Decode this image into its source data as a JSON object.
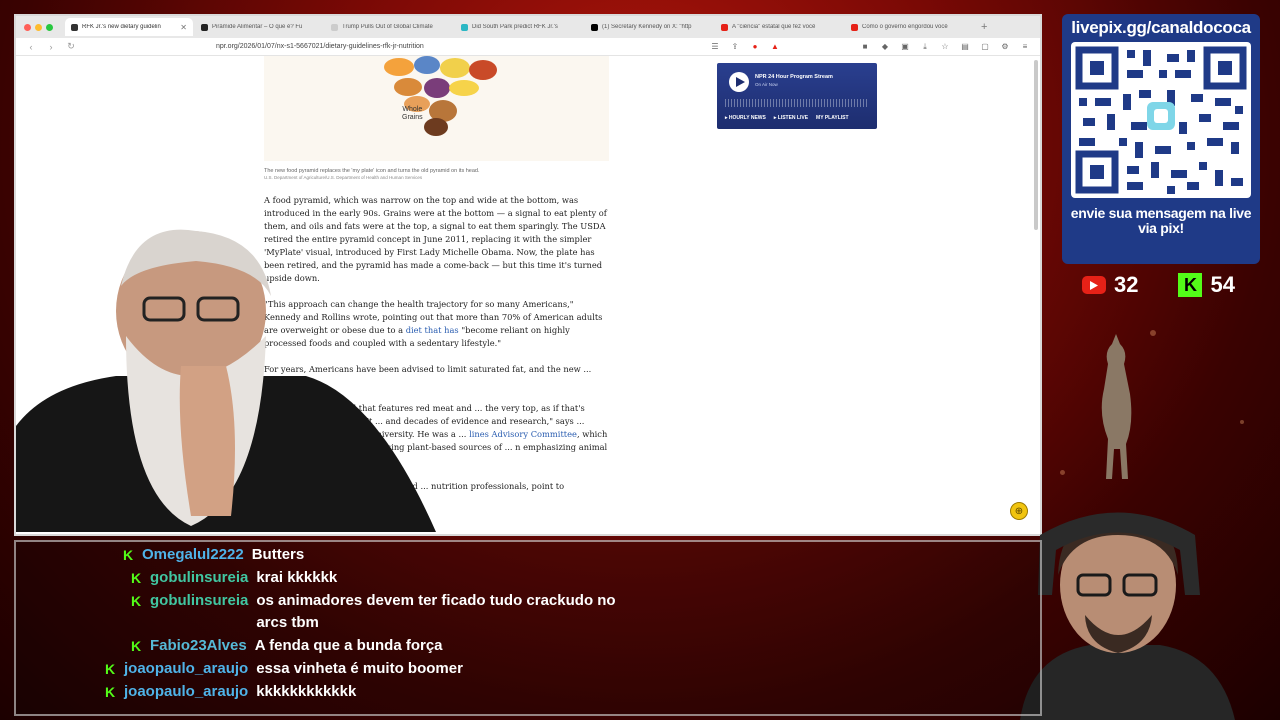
{
  "browser": {
    "tabs": [
      {
        "title": "RFK Jr.'s new dietary guidelin",
        "color": "#333333",
        "active": true
      },
      {
        "title": "Pirâmide Alimentar – O que é? Fu",
        "color": "#222222",
        "active": false
      },
      {
        "title": "Trump Pulls Out of Global Climate",
        "color": "#cccccc",
        "active": false
      },
      {
        "title": "Did South Park predict RFK Jr.'s",
        "color": "#2bb7c4",
        "active": false
      },
      {
        "title": "(1) Secretary Kennedy on X: \"http",
        "color": "#000000",
        "active": false
      },
      {
        "title": "A \"ciência\" estatal que fez você",
        "color": "#e62117",
        "active": false
      },
      {
        "title": "Como o governo engordou você",
        "color": "#e62117",
        "active": false
      }
    ],
    "new_tab": "+",
    "url": "npr.org/2026/01/07/nx-s1-5667021/dietary-guidelines-rfk-jr-nutrition"
  },
  "article": {
    "figure_label": "Whole\nGrains",
    "caption": "The new food pyramid replaces the 'my plate' icon and turns the old pyramid on its head.",
    "credit": "U.S. Department of Agriculture/U.S. Department of Health and Human Services",
    "p1": "A food pyramid, which was narrow on the top and wide at the bottom, was introduced in the early 90s. Grains were at the bottom — a signal to eat plenty of them, and oils and fats were at the top, a signal to eat them sparingly. The USDA retired the entire pyramid concept in June 2011, replacing it with the simpler 'MyPlate' visual, introduced by First Lady Michelle Obama. Now, the plate has been retired, and the pyramid has made a come-back — but this time it's turned upside down.",
    "p2_a": "\"This approach can change the health trajectory for so many Americans,\" Kennedy and Rollins wrote, pointing out that more than 70% of American adults are overweight or obese due to a ",
    "p2_link": "diet that has",
    "p2_b": " \"become reliant on highly processed foods and coupled with a sedentary lifestyle.\"",
    "p3": "For years, Americans have been advised to limit saturated fat, and the new ... criticism.",
    "p4_a": "... in the new pyramid that features red meat and ... the very top, as if that's something to prioritize. It ... and decades of evidence and research,\" says ... rition expert at Stanford University. He was a ... ",
    "p4_link": "lines Advisory Committee",
    "p4_b": ", which reviewed all ... avor of increasing plant-based sources of ... n emphasizing animal protein.",
    "p5": "... and the Academy of Nutrition and ... nutrition professionals, point to"
  },
  "player": {
    "title": "NPR 24 Hour Program Stream",
    "subtitle": "On Air Now",
    "link_news": "HOURLY NEWS",
    "link_live": "LISTEN LIVE",
    "link_playlist": "MY PLAYLIST"
  },
  "pix": {
    "header": "livepix.gg/canaldococa",
    "footer": "envie sua mensagem na live via pix!"
  },
  "counters": {
    "youtube": "32",
    "kick": "54"
  },
  "chat": [
    {
      "user": "Omegalul2222",
      "color": "#4fb3e8",
      "msg": "Butters"
    },
    {
      "user": "gobulinsureia",
      "color": "#41c6a1",
      "msg": "krai kkkkkk"
    },
    {
      "user": "gobulinsureia",
      "color": "#41c6a1",
      "msg": "os animadores devem ter ficado tudo crackudo no arcs tbm"
    },
    {
      "user": "Fabio23Alves",
      "color": "#56b9d6",
      "msg": "A fenda que a bunda força"
    },
    {
      "user": "joaopaulo_araujo",
      "color": "#4fb3e8",
      "msg": "essa vinheta é muito boomer"
    },
    {
      "user": "joaopaulo_araujo",
      "color": "#4fb3e8",
      "msg": "kkkkkkkkkkkk"
    }
  ],
  "colors": {
    "kick_green": "#53fc18",
    "youtube_red": "#e62117",
    "pix_blue": "#1f3a87",
    "npr_link": "#2a5db0"
  }
}
